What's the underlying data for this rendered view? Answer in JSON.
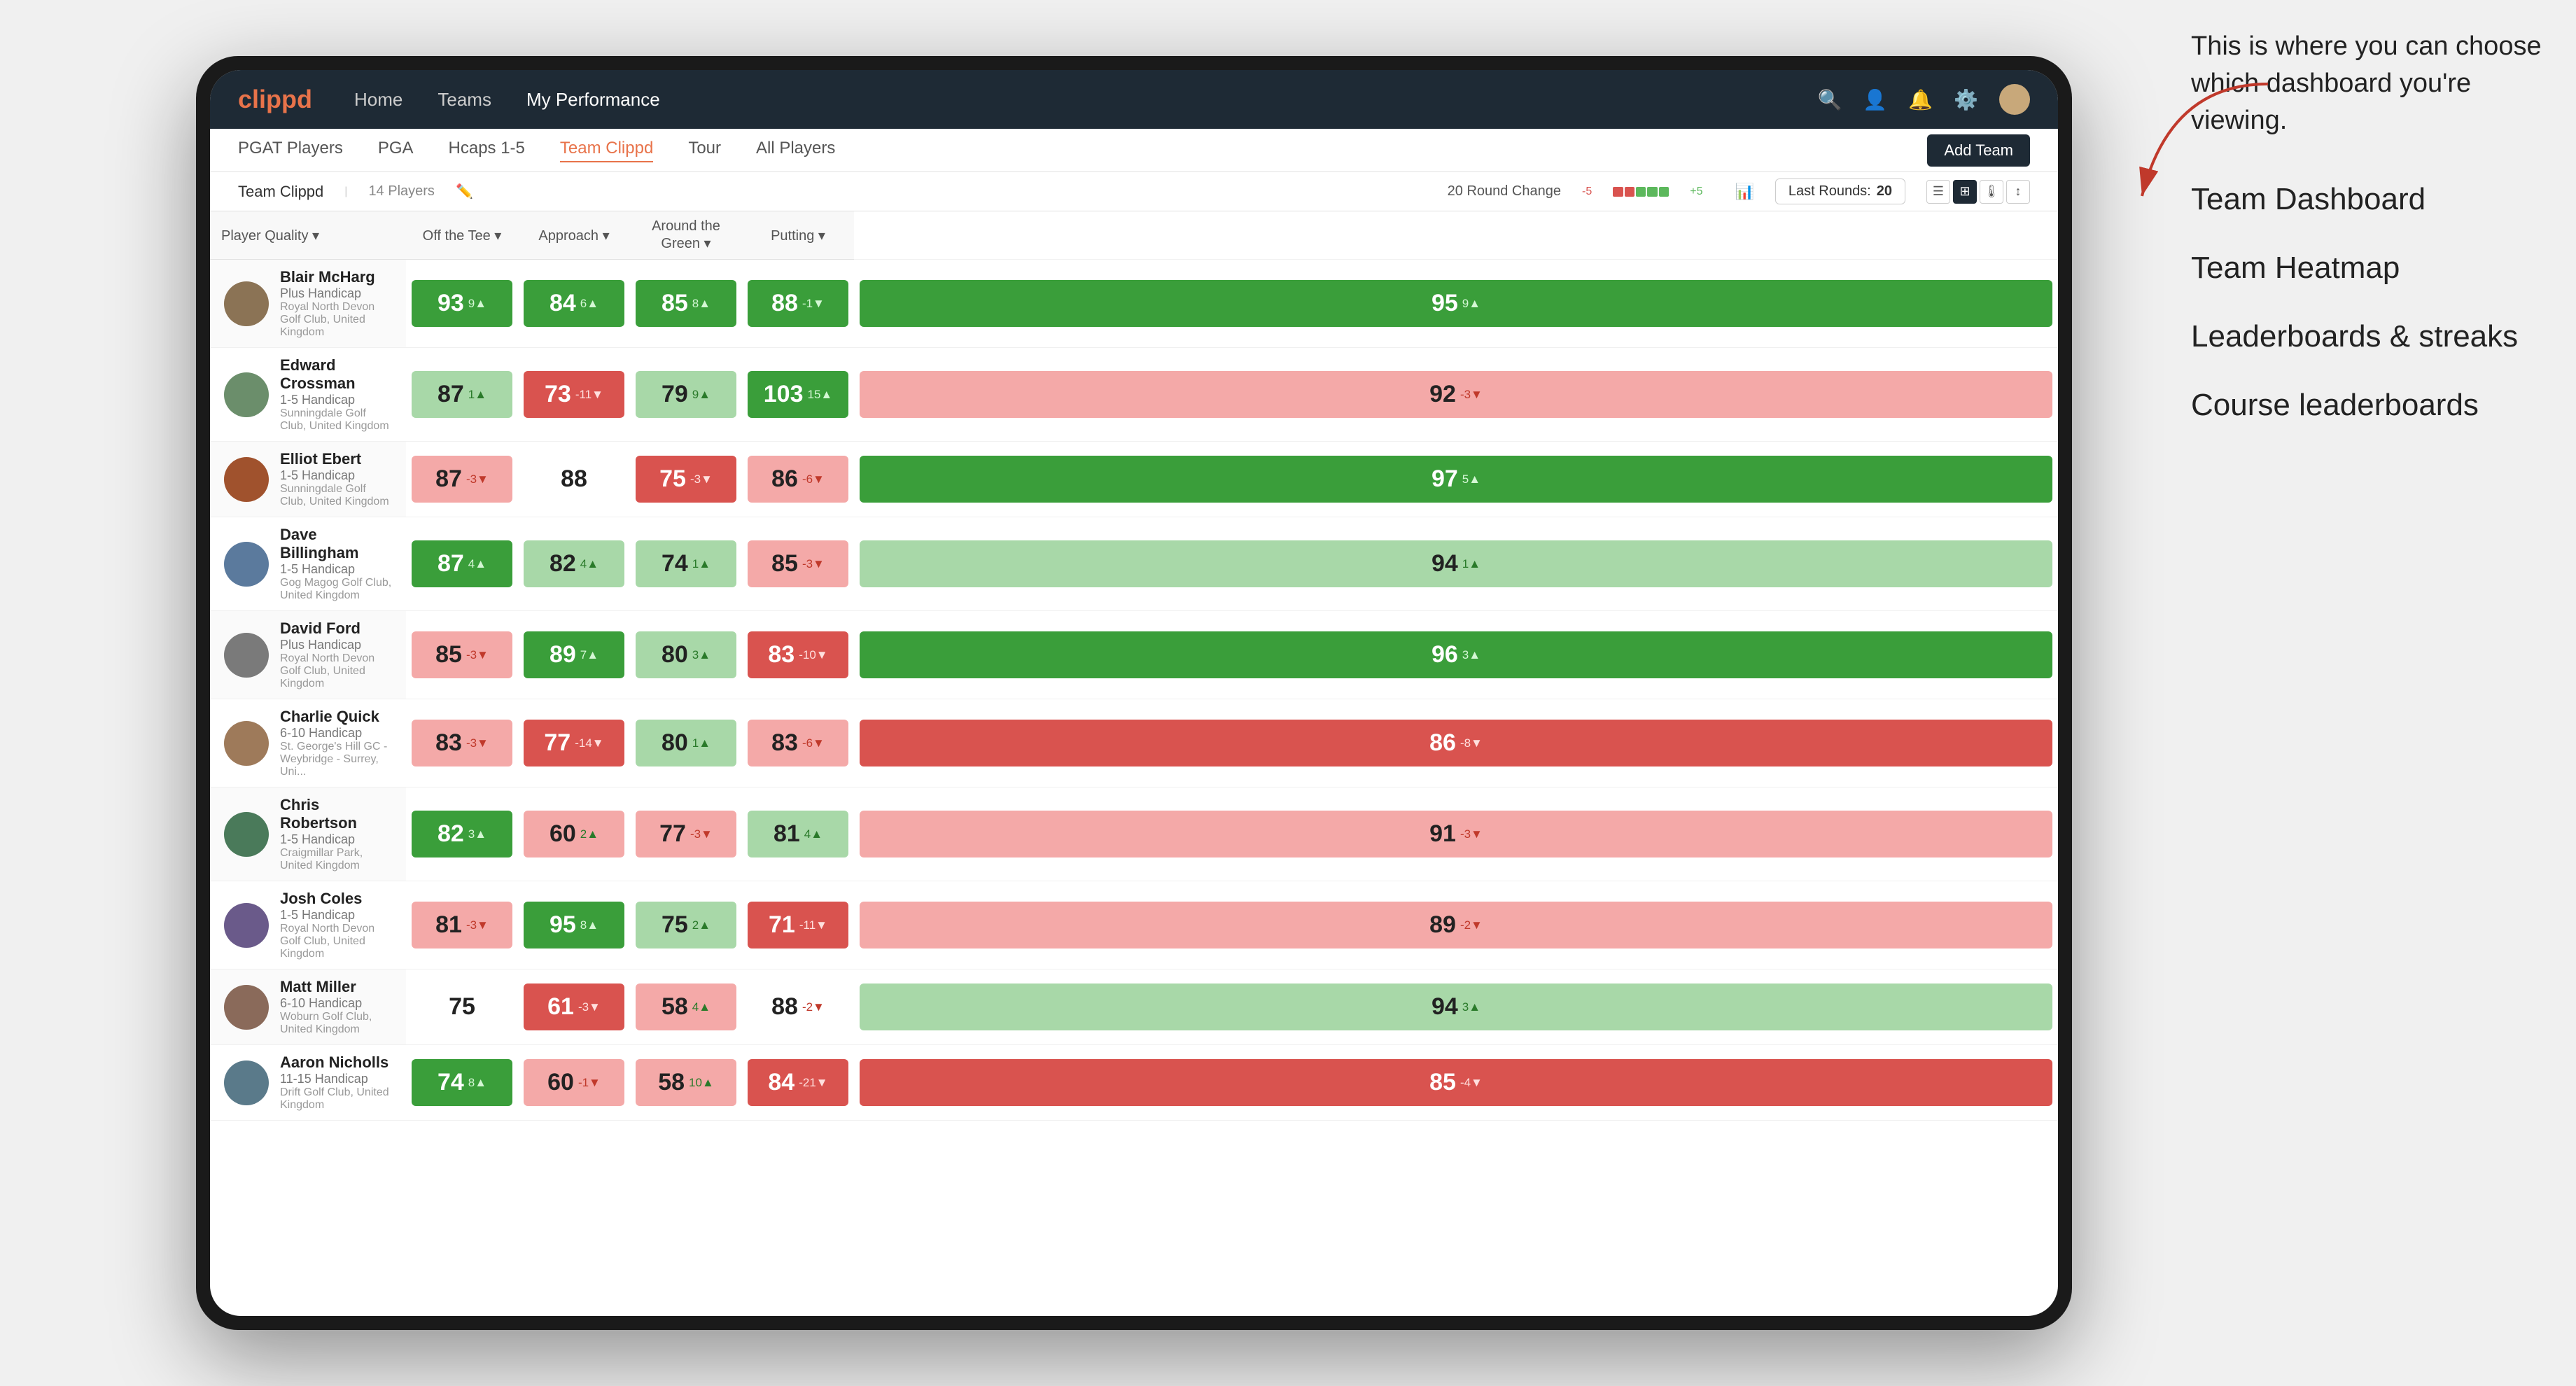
{
  "annotation": {
    "callout": "This is where you can choose which dashboard you're viewing.",
    "items": [
      "Team Dashboard",
      "Team Heatmap",
      "Leaderboards & streaks",
      "Course leaderboards"
    ]
  },
  "navbar": {
    "logo": "clippd",
    "links": [
      "Home",
      "Teams",
      "My Performance"
    ],
    "active_link": "My Performance"
  },
  "subnav": {
    "links": [
      "PGAT Players",
      "PGA",
      "Hcaps 1-5",
      "Team Clippd",
      "Tour",
      "All Players"
    ],
    "active_link": "Team Clippd",
    "add_team_label": "Add Team"
  },
  "team_header": {
    "name": "Team Clippd",
    "separator": "|",
    "count": "14 Players",
    "round_change_label": "20 Round Change",
    "neg": "-5",
    "pos": "+5",
    "last_rounds_label": "Last Rounds:",
    "last_rounds_value": "20"
  },
  "table": {
    "columns": [
      "Player Quality ▾",
      "Off the Tee ▾",
      "Approach ▾",
      "Around the Green ▾",
      "Putting ▾"
    ],
    "rows": [
      {
        "name": "Blair McHarg",
        "handicap": "Plus Handicap",
        "club": "Royal North Devon Golf Club, United Kingdom",
        "avatar_color": "#8b7355",
        "metrics": [
          {
            "val": "93",
            "change": "9▲",
            "bg": "bg-green-dark"
          },
          {
            "val": "84",
            "change": "6▲",
            "bg": "bg-green-dark"
          },
          {
            "val": "85",
            "change": "8▲",
            "bg": "bg-green-dark"
          },
          {
            "val": "88",
            "change": "-1▼",
            "bg": "bg-green-dark"
          },
          {
            "val": "95",
            "change": "9▲",
            "bg": "bg-green-dark"
          }
        ]
      },
      {
        "name": "Edward Crossman",
        "handicap": "1-5 Handicap",
        "club": "Sunningdale Golf Club, United Kingdom",
        "avatar_color": "#6b8e6b",
        "metrics": [
          {
            "val": "87",
            "change": "1▲",
            "bg": "bg-green-light"
          },
          {
            "val": "73",
            "change": "-11▼",
            "bg": "bg-red-dark"
          },
          {
            "val": "79",
            "change": "9▲",
            "bg": "bg-green-light"
          },
          {
            "val": "103",
            "change": "15▲",
            "bg": "bg-green-dark"
          },
          {
            "val": "92",
            "change": "-3▼",
            "bg": "bg-red-light"
          }
        ]
      },
      {
        "name": "Elliot Ebert",
        "handicap": "1-5 Handicap",
        "club": "Sunningdale Golf Club, United Kingdom",
        "avatar_color": "#a0522d",
        "metrics": [
          {
            "val": "87",
            "change": "-3▼",
            "bg": "bg-red-light"
          },
          {
            "val": "88",
            "change": "",
            "bg": "bg-white"
          },
          {
            "val": "75",
            "change": "-3▼",
            "bg": "bg-red-dark"
          },
          {
            "val": "86",
            "change": "-6▼",
            "bg": "bg-red-light"
          },
          {
            "val": "97",
            "change": "5▲",
            "bg": "bg-green-dark"
          }
        ]
      },
      {
        "name": "Dave Billingham",
        "handicap": "1-5 Handicap",
        "club": "Gog Magog Golf Club, United Kingdom",
        "avatar_color": "#5b7a9d",
        "metrics": [
          {
            "val": "87",
            "change": "4▲",
            "bg": "bg-green-dark"
          },
          {
            "val": "82",
            "change": "4▲",
            "bg": "bg-green-light"
          },
          {
            "val": "74",
            "change": "1▲",
            "bg": "bg-green-light"
          },
          {
            "val": "85",
            "change": "-3▼",
            "bg": "bg-red-light"
          },
          {
            "val": "94",
            "change": "1▲",
            "bg": "bg-green-light"
          }
        ]
      },
      {
        "name": "David Ford",
        "handicap": "Plus Handicap",
        "club": "Royal North Devon Golf Club, United Kingdom",
        "avatar_color": "#7a7a7a",
        "metrics": [
          {
            "val": "85",
            "change": "-3▼",
            "bg": "bg-red-light"
          },
          {
            "val": "89",
            "change": "7▲",
            "bg": "bg-green-dark"
          },
          {
            "val": "80",
            "change": "3▲",
            "bg": "bg-green-light"
          },
          {
            "val": "83",
            "change": "-10▼",
            "bg": "bg-red-dark"
          },
          {
            "val": "96",
            "change": "3▲",
            "bg": "bg-green-dark"
          }
        ]
      },
      {
        "name": "Charlie Quick",
        "handicap": "6-10 Handicap",
        "club": "St. George's Hill GC - Weybridge - Surrey, Uni...",
        "avatar_color": "#9e7a5a",
        "metrics": [
          {
            "val": "83",
            "change": "-3▼",
            "bg": "bg-red-light"
          },
          {
            "val": "77",
            "change": "-14▼",
            "bg": "bg-red-dark"
          },
          {
            "val": "80",
            "change": "1▲",
            "bg": "bg-green-light"
          },
          {
            "val": "83",
            "change": "-6▼",
            "bg": "bg-red-light"
          },
          {
            "val": "86",
            "change": "-8▼",
            "bg": "bg-red-dark"
          }
        ]
      },
      {
        "name": "Chris Robertson",
        "handicap": "1-5 Handicap",
        "club": "Craigmillar Park, United Kingdom",
        "avatar_color": "#4a7a5a",
        "metrics": [
          {
            "val": "82",
            "change": "3▲",
            "bg": "bg-green-dark"
          },
          {
            "val": "60",
            "change": "2▲",
            "bg": "bg-red-light"
          },
          {
            "val": "77",
            "change": "-3▼",
            "bg": "bg-red-light"
          },
          {
            "val": "81",
            "change": "4▲",
            "bg": "bg-green-light"
          },
          {
            "val": "91",
            "change": "-3▼",
            "bg": "bg-red-light"
          }
        ]
      },
      {
        "name": "Josh Coles",
        "handicap": "1-5 Handicap",
        "club": "Royal North Devon Golf Club, United Kingdom",
        "avatar_color": "#6a5a8a",
        "metrics": [
          {
            "val": "81",
            "change": "-3▼",
            "bg": "bg-red-light"
          },
          {
            "val": "95",
            "change": "8▲",
            "bg": "bg-green-dark"
          },
          {
            "val": "75",
            "change": "2▲",
            "bg": "bg-green-light"
          },
          {
            "val": "71",
            "change": "-11▼",
            "bg": "bg-red-dark"
          },
          {
            "val": "89",
            "change": "-2▼",
            "bg": "bg-red-light"
          }
        ]
      },
      {
        "name": "Matt Miller",
        "handicap": "6-10 Handicap",
        "club": "Woburn Golf Club, United Kingdom",
        "avatar_color": "#8a6a5a",
        "metrics": [
          {
            "val": "75",
            "change": "",
            "bg": "bg-white"
          },
          {
            "val": "61",
            "change": "-3▼",
            "bg": "bg-red-dark"
          },
          {
            "val": "58",
            "change": "4▲",
            "bg": "bg-red-light"
          },
          {
            "val": "88",
            "change": "-2▼",
            "bg": "bg-white"
          },
          {
            "val": "94",
            "change": "3▲",
            "bg": "bg-green-light"
          }
        ]
      },
      {
        "name": "Aaron Nicholls",
        "handicap": "11-15 Handicap",
        "club": "Drift Golf Club, United Kingdom",
        "avatar_color": "#5a7a8a",
        "metrics": [
          {
            "val": "74",
            "change": "8▲",
            "bg": "bg-green-dark"
          },
          {
            "val": "60",
            "change": "-1▼",
            "bg": "bg-red-light"
          },
          {
            "val": "58",
            "change": "10▲",
            "bg": "bg-red-light"
          },
          {
            "val": "84",
            "change": "-21▼",
            "bg": "bg-red-dark"
          },
          {
            "val": "85",
            "change": "-4▼",
            "bg": "bg-red-dark"
          }
        ]
      }
    ]
  }
}
